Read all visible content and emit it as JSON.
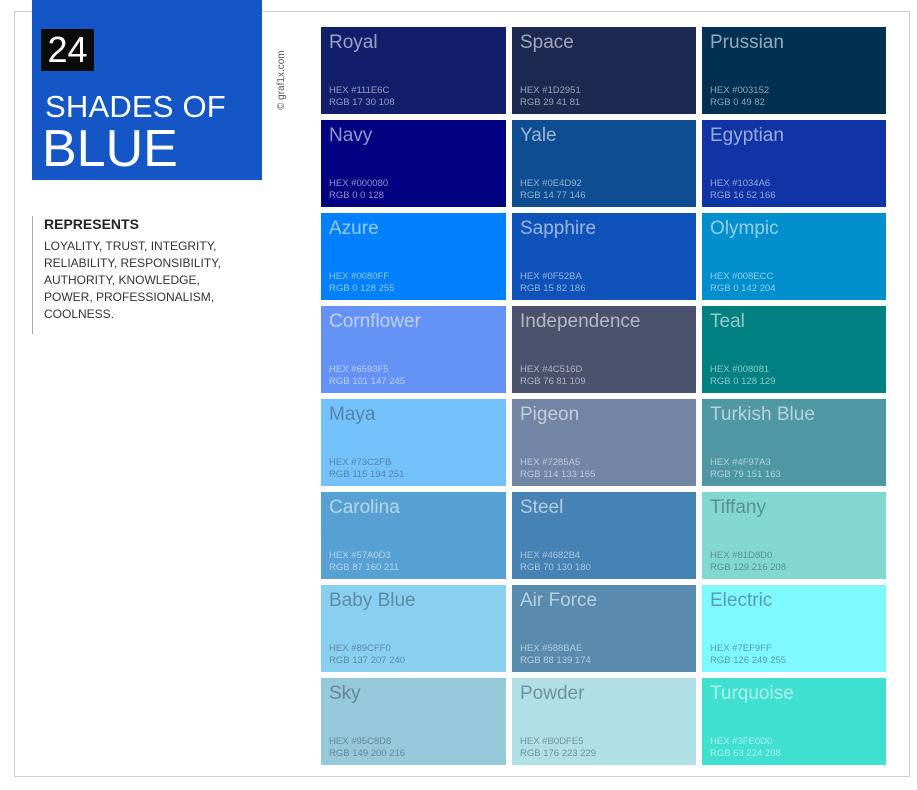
{
  "header": {
    "count": "24",
    "line1": "SHADES OF",
    "line2": "BLUE",
    "credit": "© graf1x.com"
  },
  "represents": {
    "title": "REPRESENTS",
    "text": "LOYALITY, TRUST, INTEGRITY, RELIABILITY, RESPONSIBILITY, AUTHORITY, KNOWLEDGE, POWER, PROFESSIONALISM, COOLNESS."
  },
  "swatches": [
    {
      "name": "Royal",
      "hex": "HEX #111E6C",
      "rgb": "RGB 17 30 108",
      "color": "#111E6C"
    },
    {
      "name": "Space",
      "hex": "HEX #1D2951",
      "rgb": "RGB 29 41 81",
      "color": "#1D2951"
    },
    {
      "name": "Prussian",
      "hex": "HEX #003152",
      "rgb": "RGB 0 49 82",
      "color": "#003152"
    },
    {
      "name": "Navy",
      "hex": "HEX #000080",
      "rgb": "RGB 0 0 128",
      "color": "#000080"
    },
    {
      "name": "Yale",
      "hex": "HEX #0E4D92",
      "rgb": "RGB 14 77 146",
      "color": "#0E4D92"
    },
    {
      "name": "Egyptian",
      "hex": "HEX #1034A6",
      "rgb": "RGB 16 52 166",
      "color": "#1034A6"
    },
    {
      "name": "Azure",
      "hex": "HEX #0080FF",
      "rgb": "RGB 0 128 255",
      "color": "#0080FF"
    },
    {
      "name": "Sapphire",
      "hex": "HEX #0F52BA",
      "rgb": "RGB 15 82 186",
      "color": "#0F52BA"
    },
    {
      "name": "Olympic",
      "hex": "HEX #008ECC",
      "rgb": "RGB 0 142 204",
      "color": "#008ECC"
    },
    {
      "name": "Cornflower",
      "hex": "HEX #6593F5",
      "rgb": "RGB 101 147 245",
      "color": "#6593F5"
    },
    {
      "name": "Independence",
      "hex": "HEX #4C516D",
      "rgb": "RGB 76 81 109",
      "color": "#4C516D"
    },
    {
      "name": "Teal",
      "hex": "HEX #008081",
      "rgb": "RGB 0 128 129",
      "color": "#008081"
    },
    {
      "name": "Maya",
      "hex": "HEX #73C2FB",
      "rgb": "RGB 115 194 251",
      "color": "#73C2FB"
    },
    {
      "name": "Pigeon",
      "hex": "HEX #7285A5",
      "rgb": "RGB 114 133 165",
      "color": "#7285A5"
    },
    {
      "name": "Turkish Blue",
      "hex": "HEX #4F97A3",
      "rgb": "RGB 79 151 163",
      "color": "#4F97A3"
    },
    {
      "name": "Carolina",
      "hex": "HEX #57A0D3",
      "rgb": "RGB 87 160 211",
      "color": "#57A0D3"
    },
    {
      "name": "Steel",
      "hex": "HEX #4682B4",
      "rgb": "RGB 70 130 180",
      "color": "#4682B4"
    },
    {
      "name": "Tiffany",
      "hex": "HEX #81D8D0",
      "rgb": "RGB 129 216 208",
      "color": "#81D8D0"
    },
    {
      "name": "Baby Blue",
      "hex": "HEX #89CFF0",
      "rgb": "RGB 137 207 240",
      "color": "#89CFF0"
    },
    {
      "name": "Air Force",
      "hex": "HEX #588BAE",
      "rgb": "RGB 88 139 174",
      "color": "#588BAE"
    },
    {
      "name": "Electric",
      "hex": "HEX #7EF9FF",
      "rgb": "RGB 126 249 255",
      "color": "#7EF9FF"
    },
    {
      "name": "Sky",
      "hex": "HEX #95C8D8",
      "rgb": "RGB 149 200 216",
      "color": "#95C8D8"
    },
    {
      "name": "Powder",
      "hex": "HEX #B0DFE5",
      "rgb": "RGB 176 223 229",
      "color": "#B0DFE5"
    },
    {
      "name": "Turquoise",
      "hex": "HEX #3FE0D0",
      "rgb": "RGB 63 224 208",
      "color": "#3FE0D0"
    }
  ]
}
